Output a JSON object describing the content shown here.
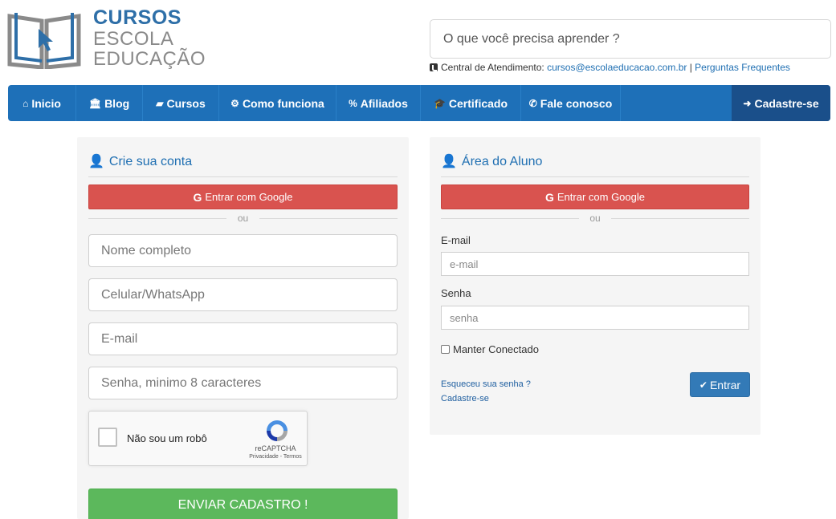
{
  "logo": {
    "line1": "CURSOS",
    "line2": "ESCOLA",
    "line3": "EDUCAÇÃO",
    "icon": "book-cursor-icon"
  },
  "search": {
    "placeholder": "O que você precisa aprender ?"
  },
  "contact": {
    "label": "Central de Atendimento:",
    "email": "cursos@escolaeducacao.com.br",
    "separator": "|",
    "faq": "Perguntas Frequentes"
  },
  "nav": {
    "items": [
      {
        "label": "Inicio",
        "icon": "home-icon"
      },
      {
        "label": "Blog",
        "icon": "institution-icon"
      },
      {
        "label": "Cursos",
        "icon": "book-icon"
      },
      {
        "label": "Como funciona",
        "icon": "gears-icon"
      },
      {
        "label": "Afiliados",
        "icon": "link-icon"
      },
      {
        "label": "Certificado",
        "icon": "graduation-cap-icon"
      },
      {
        "label": "Fale conosco",
        "icon": "phone-icon"
      }
    ],
    "signup": {
      "label": "Cadastre-se",
      "icon": "sign-in-icon"
    }
  },
  "register": {
    "title": "Crie sua conta",
    "google": "Entrar com Google",
    "or": "ou",
    "name_placeholder": "Nome completo",
    "phone_placeholder": "Celular/WhatsApp",
    "email_placeholder": "E-mail",
    "password_placeholder": "Senha, minimo 8 caracteres",
    "captcha": {
      "label": "Não sou um robô",
      "brand": "reCAPTCHA",
      "links": "Privacidade - Termos"
    },
    "submit": "ENVIAR CADASTRO !"
  },
  "login": {
    "title": "Área do Aluno",
    "google": "Entrar com Google",
    "or": "ou",
    "email_label": "E-mail",
    "email_placeholder": "e-mail",
    "password_label": "Senha",
    "password_placeholder": "senha",
    "keep": "Manter Conectado",
    "forgot": "Esqueceu sua senha ?",
    "signup": "Cadastre-se",
    "submit": "Entrar"
  },
  "colors": {
    "nav": "#1e70b8",
    "nav_signup": "#1a4f8a",
    "google": "#d9534f",
    "submit": "#5cb85c",
    "primary": "#337ab7"
  }
}
